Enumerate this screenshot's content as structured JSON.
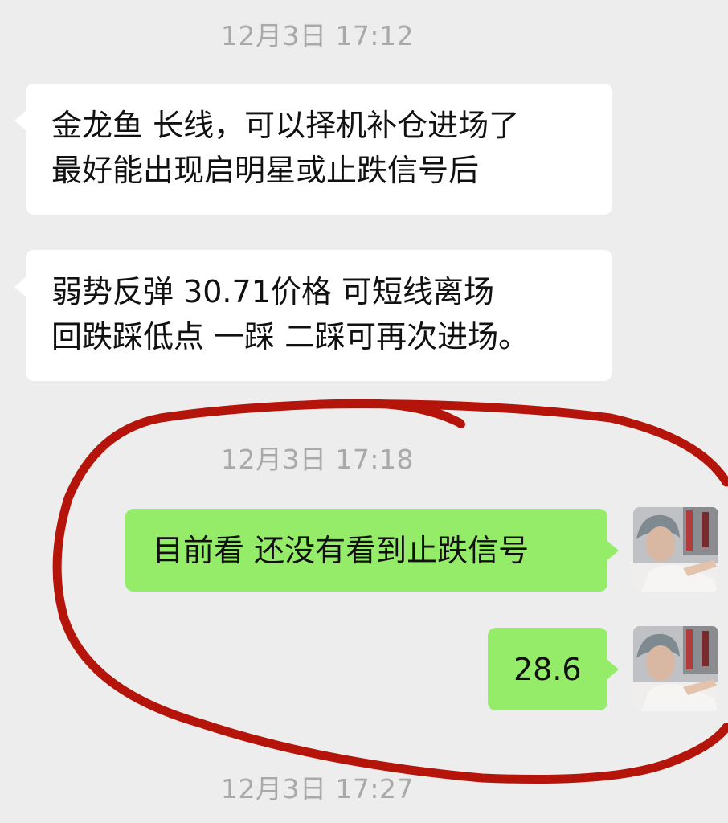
{
  "chat": {
    "messages": [
      {
        "type": "timestamp",
        "text": "12月3日 17:12"
      },
      {
        "type": "incoming",
        "lines": [
          "金龙鱼  长线，可以择机补仓进场了",
          "最好能出现启明星或止跌信号后"
        ]
      },
      {
        "type": "incoming",
        "lines": [
          "弱势反弹 30.71价格  可短线离场",
          "回跌踩低点  一踩  二踩可再次进场。"
        ]
      },
      {
        "type": "timestamp",
        "text": "12月3日 17:18"
      },
      {
        "type": "outgoing",
        "lines": [
          "目前看 还没有看到止跌信号"
        ]
      },
      {
        "type": "outgoing",
        "lines": [
          "28.6"
        ]
      },
      {
        "type": "timestamp",
        "text": "12月3日 17:27"
      }
    ]
  },
  "colors": {
    "background": "#ededed",
    "incoming_bubble": "#ffffff",
    "outgoing_bubble": "#95ec69",
    "timestamp_text": "#a9a9a9",
    "annotation_stroke": "#b4140a"
  },
  "icons": {
    "self_avatar": "user-photo-avatar",
    "annotation": "red-hand-drawn-circle"
  }
}
